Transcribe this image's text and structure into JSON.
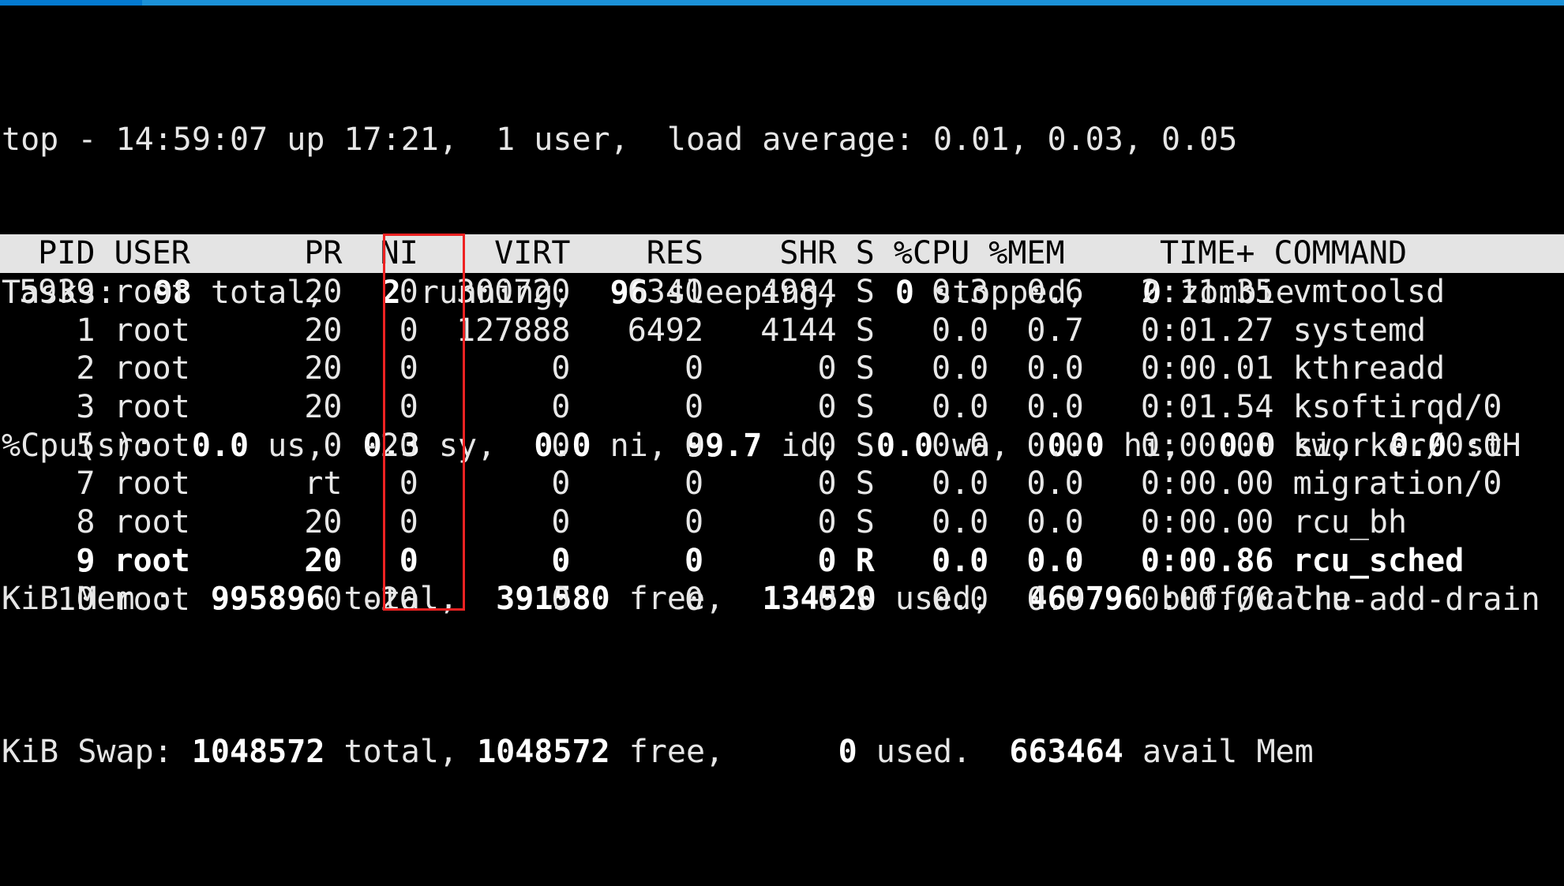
{
  "app": {
    "name": "top",
    "window_title": "top"
  },
  "topbar": {
    "color": "#1b91d8",
    "progress_color": "#047ad0"
  },
  "summary": {
    "line1": "top - 14:59:07 up 17:21,  1 user,  load average: 0.01, 0.03, 0.05",
    "uptime_clock": "14:59:07",
    "uptime": "17:21",
    "users": "1 user",
    "load_average": [
      "0.01",
      "0.03",
      "0.05"
    ],
    "tasks": {
      "label": "Tasks:",
      "total": "98",
      "running": "2",
      "sleeping": "96",
      "stopped": "0",
      "zombie": "0",
      "line_prefix": "Tasks:  ",
      "seg_total": "98",
      "seg_total_label": " total,   ",
      "seg_running": "2",
      "seg_running_label": " running,  ",
      "seg_sleeping": "96",
      "seg_sleeping_label": " sleeping,   ",
      "seg_stopped": "0",
      "seg_stopped_label": " stopped,   ",
      "seg_zombie": "0",
      "seg_zombie_label": " zombie"
    },
    "cpu": {
      "label": "%Cpu(s):  ",
      "us": "0.0",
      "us_label": " us,  ",
      "sy": "0.3",
      "sy_label": " sy,  ",
      "ni": "0.0",
      "ni_label": " ni, ",
      "id": "99.7",
      "id_label": " id,  ",
      "wa": "0.0",
      "wa_label": " wa,  ",
      "hi": "0.0",
      "hi_label": " hi,  ",
      "si": "0.0",
      "si_label": " si,  ",
      "st": "0.0",
      "st_label": " st"
    },
    "mem": {
      "label": "KiB Mem :  ",
      "total": "995896",
      "total_label": " total,  ",
      "free": "391580",
      "free_label": " free,  ",
      "used": "134520",
      "used_label": " used,  ",
      "buffcache": "469796",
      "buffcache_label": " buff/cache"
    },
    "swap": {
      "label": "KiB Swap: ",
      "total": "1048572",
      "total_label": " total, ",
      "free": "1048572",
      "free_label": " free,      ",
      "used": "0",
      "used_label": " used.  ",
      "avail": "663464",
      "avail_label": " avail Mem"
    }
  },
  "table": {
    "header": "  PID USER      PR  NI    VIRT    RES    SHR S %CPU %MEM     TIME+ COMMAND",
    "columns": [
      "PID",
      "USER",
      "PR",
      "NI",
      "VIRT",
      "RES",
      "SHR",
      "S",
      "%CPU",
      "%MEM",
      "TIME+",
      "COMMAND"
    ],
    "highlighted_column": "NI",
    "highlight_color": "#ee2222",
    "rows": [
      {
        "text": " 5939 root      20   0  300720   6340   4984 S   0.3  0.6   2:11.35 vmtoolsd",
        "pid": "5939",
        "user": "root",
        "pr": "20",
        "ni": "0",
        "virt": "300720",
        "res": "6340",
        "shr": "4984",
        "s": "S",
        "cpu": "0.3",
        "mem": "0.6",
        "time": "2:11.35",
        "command": "vmtoolsd",
        "bold": false
      },
      {
        "text": "    1 root      20   0  127888   6492   4144 S   0.0  0.7   0:01.27 systemd",
        "pid": "1",
        "user": "root",
        "pr": "20",
        "ni": "0",
        "virt": "127888",
        "res": "6492",
        "shr": "4144",
        "s": "S",
        "cpu": "0.0",
        "mem": "0.7",
        "time": "0:01.27",
        "command": "systemd",
        "bold": false
      },
      {
        "text": "    2 root      20   0       0      0      0 S   0.0  0.0   0:00.01 kthreadd",
        "pid": "2",
        "user": "root",
        "pr": "20",
        "ni": "0",
        "virt": "0",
        "res": "0",
        "shr": "0",
        "s": "S",
        "cpu": "0.0",
        "mem": "0.0",
        "time": "0:00.01",
        "command": "kthreadd",
        "bold": false
      },
      {
        "text": "    3 root      20   0       0      0      0 S   0.0  0.0   0:01.54 ksoftirqd/0",
        "pid": "3",
        "user": "root",
        "pr": "20",
        "ni": "0",
        "virt": "0",
        "res": "0",
        "shr": "0",
        "s": "S",
        "cpu": "0.0",
        "mem": "0.0",
        "time": "0:01.54",
        "command": "ksoftirqd/0",
        "bold": false
      },
      {
        "text": "    5 root       0 -20       0      0      0 S   0.0  0.0   0:00.00 kworker/0:0H",
        "pid": "5",
        "user": "root",
        "pr": "0",
        "ni": "-20",
        "virt": "0",
        "res": "0",
        "shr": "0",
        "s": "S",
        "cpu": "0.0",
        "mem": "0.0",
        "time": "0:00.00",
        "command": "kworker/0:0H",
        "bold": false
      },
      {
        "text": "    7 root      rt   0       0      0      0 S   0.0  0.0   0:00.00 migration/0",
        "pid": "7",
        "user": "root",
        "pr": "rt",
        "ni": "0",
        "virt": "0",
        "res": "0",
        "shr": "0",
        "s": "S",
        "cpu": "0.0",
        "mem": "0.0",
        "time": "0:00.00",
        "command": "migration/0",
        "bold": false
      },
      {
        "text": "    8 root      20   0       0      0      0 S   0.0  0.0   0:00.00 rcu_bh",
        "pid": "8",
        "user": "root",
        "pr": "20",
        "ni": "0",
        "virt": "0",
        "res": "0",
        "shr": "0",
        "s": "S",
        "cpu": "0.0",
        "mem": "0.0",
        "time": "0:00.00",
        "command": "rcu_bh",
        "bold": false
      },
      {
        "text": "    9 root      20   0       0      0      0 R   0.0  0.0   0:00.86 rcu_sched",
        "pid": "9",
        "user": "root",
        "pr": "20",
        "ni": "0",
        "virt": "0",
        "res": "0",
        "shr": "0",
        "s": "R",
        "cpu": "0.0",
        "mem": "0.0",
        "time": "0:00.86",
        "command": "rcu_sched",
        "bold": true
      },
      {
        "text": "   10 root       0 -20       0      0      0 S   0.0  0.0   0:00.00 lru-add-drain",
        "pid": "10",
        "user": "root",
        "pr": "0",
        "ni": "-20",
        "virt": "0",
        "res": "0",
        "shr": "0",
        "s": "S",
        "cpu": "0.0",
        "mem": "0.0",
        "time": "0:00.00",
        "command": "lru-add-drain",
        "bold": false
      }
    ]
  }
}
